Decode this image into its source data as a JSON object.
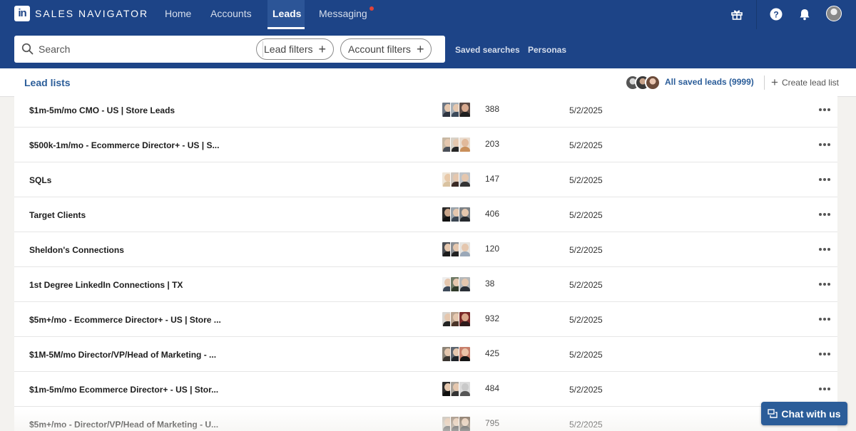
{
  "app": {
    "logo_mark": "in",
    "product_name": "SALES NAVIGATOR",
    "brand_color": "#1d4487",
    "accent_color": "#2b5d99"
  },
  "nav": {
    "items": [
      {
        "label": "Home"
      },
      {
        "label": "Accounts"
      },
      {
        "label": "Leads",
        "active": true
      },
      {
        "label": "Messaging",
        "has_notification": true
      }
    ],
    "icons": [
      "gift-icon",
      "help-icon",
      "bell-icon",
      "user-avatar"
    ]
  },
  "search": {
    "placeholder": "Search",
    "lead_filters_label": "Lead filters",
    "account_filters_label": "Account filters",
    "saved_searches_label": "Saved searches",
    "personas_label": "Personas"
  },
  "tabs": {
    "active_label": "Lead lists",
    "all_saved_leads_label": "All saved leads (9999)",
    "create_lead_list_label": "Create lead list"
  },
  "lead_lists": [
    {
      "name": "$1m-5m/mo CMO - US | Store Leads",
      "count": "388",
      "date": "5/2/2025"
    },
    {
      "name": "$500k-1m/mo - Ecommerce Director+ - US | S...",
      "count": "203",
      "date": "5/2/2025"
    },
    {
      "name": "SQLs",
      "count": "147",
      "date": "5/2/2025"
    },
    {
      "name": "Target Clients",
      "count": "406",
      "date": "5/2/2025"
    },
    {
      "name": "Sheldon's Connections",
      "count": "120",
      "date": "5/2/2025"
    },
    {
      "name": "1st Degree LinkedIn Connections | TX",
      "count": "38",
      "date": "5/2/2025"
    },
    {
      "name": "$5m+/mo - Ecommerce Director+ - US | Store ...",
      "count": "932",
      "date": "5/2/2025"
    },
    {
      "name": "$1M-5M/mo Director/VP/Head of Marketing - ...",
      "count": "425",
      "date": "5/2/2025"
    },
    {
      "name": "$1m-5m/mo Ecommerce Director+ - US | Stor...",
      "count": "484",
      "date": "5/2/2025"
    },
    {
      "name": "$5m+/mo - Director/VP/Head of Marketing - U...",
      "count": "795",
      "date": "5/2/2025"
    }
  ],
  "chat": {
    "label": "Chat with us"
  }
}
